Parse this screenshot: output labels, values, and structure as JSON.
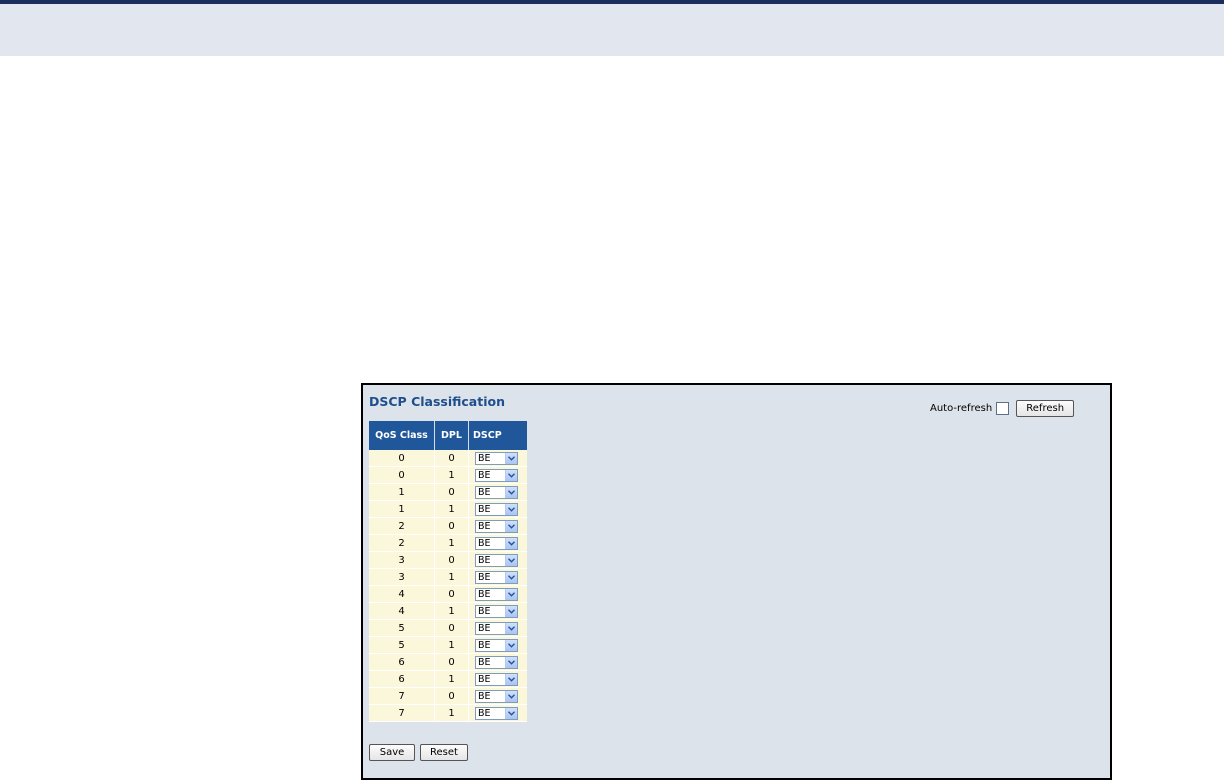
{
  "panel": {
    "title": "DSCP Classification",
    "auto_refresh_label": "Auto-refresh",
    "auto_refresh_checked": false,
    "refresh_label": "Refresh"
  },
  "table": {
    "headers": [
      "QoS Class",
      "DPL",
      "DSCP"
    ],
    "rows": [
      {
        "qos_class": "0",
        "dpl": "0",
        "dscp": "BE"
      },
      {
        "qos_class": "0",
        "dpl": "1",
        "dscp": "BE"
      },
      {
        "qos_class": "1",
        "dpl": "0",
        "dscp": "BE"
      },
      {
        "qos_class": "1",
        "dpl": "1",
        "dscp": "BE"
      },
      {
        "qos_class": "2",
        "dpl": "0",
        "dscp": "BE"
      },
      {
        "qos_class": "2",
        "dpl": "1",
        "dscp": "BE"
      },
      {
        "qos_class": "3",
        "dpl": "0",
        "dscp": "BE"
      },
      {
        "qos_class": "3",
        "dpl": "1",
        "dscp": "BE"
      },
      {
        "qos_class": "4",
        "dpl": "0",
        "dscp": "BE"
      },
      {
        "qos_class": "4",
        "dpl": "1",
        "dscp": "BE"
      },
      {
        "qos_class": "5",
        "dpl": "0",
        "dscp": "BE"
      },
      {
        "qos_class": "5",
        "dpl": "1",
        "dscp": "BE"
      },
      {
        "qos_class": "6",
        "dpl": "0",
        "dscp": "BE"
      },
      {
        "qos_class": "6",
        "dpl": "1",
        "dscp": "BE"
      },
      {
        "qos_class": "7",
        "dpl": "0",
        "dscp": "BE"
      },
      {
        "qos_class": "7",
        "dpl": "1",
        "dscp": "BE"
      }
    ]
  },
  "actions": {
    "save_label": "Save",
    "reset_label": "Reset"
  },
  "icons": {
    "dropdown": "chevron-down-icon"
  },
  "colors": {
    "title": "#1f4e8c",
    "header_bg": "#20579a",
    "cell_bg": "#fbf7da",
    "panel_bg": "#dde3ea",
    "top_bar": "#1b2d5c"
  }
}
